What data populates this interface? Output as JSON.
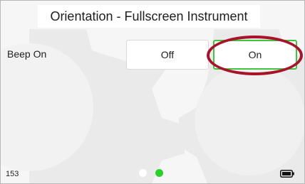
{
  "header": {
    "title": "Orientation - Fullscreen Instrument"
  },
  "setting": {
    "label": "Beep On",
    "options": [
      "Off",
      "On"
    ],
    "selected": "On"
  },
  "footer": {
    "page_number": "153",
    "pager": {
      "total": 2,
      "current": 2
    },
    "status_icon": "battery-icon"
  },
  "colors": {
    "selected_border": "#41c541",
    "active_dot": "#2ad12a",
    "highlight_ring": "#a8132a"
  }
}
